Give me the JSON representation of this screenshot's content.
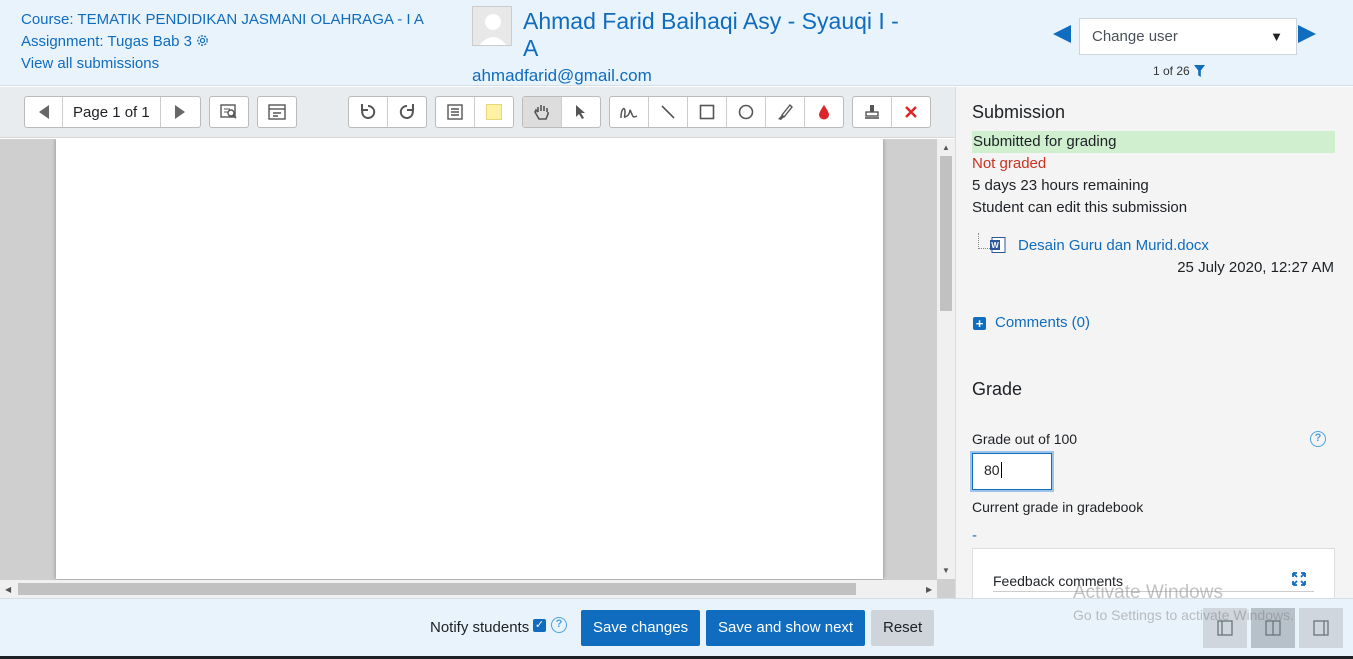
{
  "header": {
    "course": "Course: TEMATIK PENDIDIKAN JASMANI OLAHRAGA - I A",
    "assignment": "Assignment: Tugas Bab 3",
    "view_all": "View all submissions",
    "user_name": "Ahmad Farid Baihaqi Asy - Syauqi I - A",
    "user_email": "ahmadfarid@gmail.com",
    "change_user": "Change user",
    "count": "1 of 26"
  },
  "toolbar": {
    "page_label": "Page 1 of 1"
  },
  "submission": {
    "heading": "Submission",
    "status": "Submitted for grading",
    "grading_status": "Not graded",
    "time_remaining": "5 days 23 hours remaining",
    "edit_note": "Student can edit this submission",
    "file_name": "Desain Guru dan Murid.docx",
    "file_date": "25 July 2020, 12:27 AM",
    "comments": "Comments (0)"
  },
  "grade": {
    "heading": "Grade",
    "label": "Grade out of 100",
    "value": "80",
    "current_label": "Current grade in gradebook",
    "current_value": "-",
    "feedback_label": "Feedback comments"
  },
  "footer": {
    "notify_label": "Notify students",
    "save_changes": "Save changes",
    "save_next": "Save and show next",
    "reset": "Reset"
  },
  "watermark": {
    "title": "Activate Windows",
    "subtitle": "Go to Settings to activate Windows."
  },
  "colors": {
    "accent": "#0f6cbf",
    "success_bg": "#cfefcf",
    "danger": "#ca3120"
  }
}
